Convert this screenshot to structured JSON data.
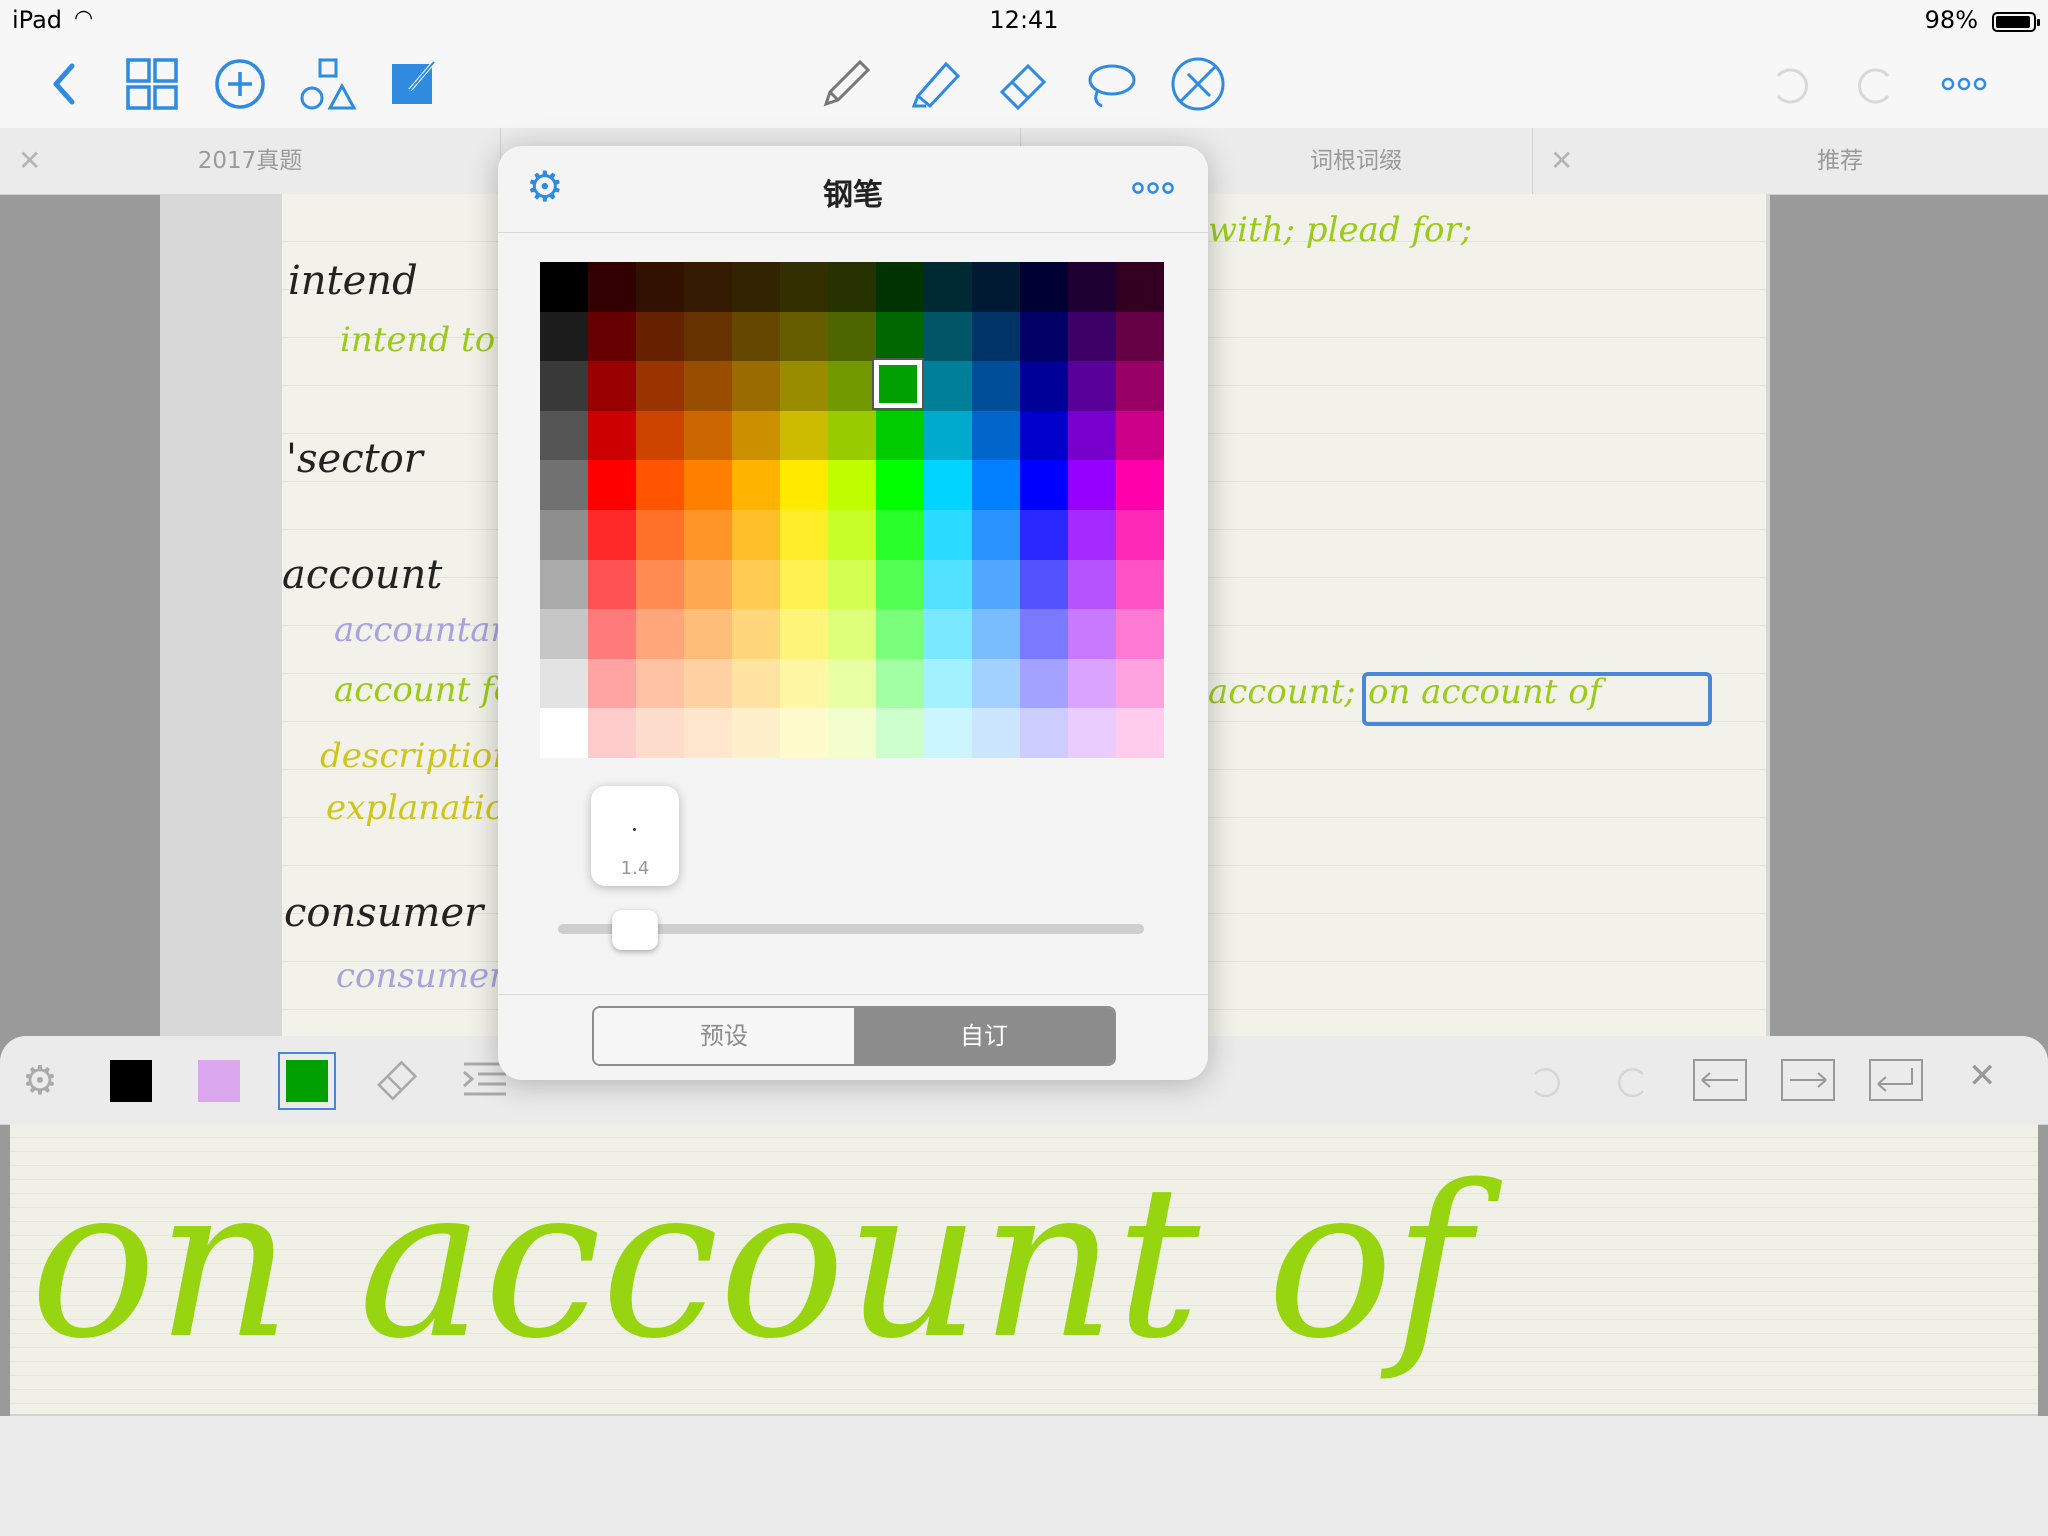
{
  "status_bar": {
    "device": "iPad",
    "time": "12:41",
    "battery": "98%"
  },
  "toolbar": {
    "left_icons": [
      "back-icon",
      "grid-icon",
      "add-icon",
      "shapes-icon",
      "edit-icon"
    ],
    "center_icons": [
      "pen-icon",
      "highlighter-icon",
      "eraser-icon",
      "lasso-icon",
      "no-touch-icon"
    ],
    "right_icons": [
      "undo-icon",
      "redo-icon",
      "more-icon"
    ],
    "pen_indicator_color": "#14a61e",
    "highlighter_indicator_color": "#a4d21a"
  },
  "tabs": [
    {
      "label": "2017真题"
    },
    {
      "label": ""
    },
    {
      "label": "词根词缀"
    },
    {
      "label": "推荐"
    }
  ],
  "notes": {
    "left_words": [
      "intend",
      "intend to",
      "'sector",
      "account",
      "accountant",
      "account for",
      "description",
      "explanation",
      "consumer",
      "consumer"
    ],
    "right_words": [
      "with; plead for;",
      "account;",
      "on account of"
    ]
  },
  "popover": {
    "title": "钢笔",
    "size_value": "1.4",
    "size_fraction": 0.1,
    "segments": [
      "预设",
      "自订"
    ],
    "active_segment": 1,
    "selected_color": "#00a000"
  },
  "bottom_panel": {
    "swatches": [
      "#000000",
      "#dba8f0",
      "#00a000"
    ],
    "selected_swatch": 2,
    "canvas_text": "on account of"
  }
}
